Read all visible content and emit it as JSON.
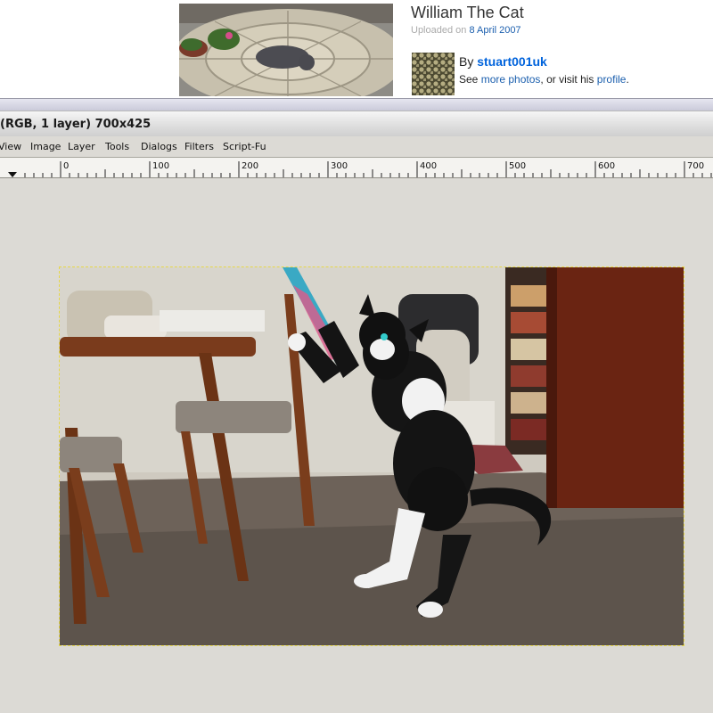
{
  "web_page": {
    "photo_title": "William The Cat",
    "uploaded_prefix": "Uploaded on",
    "uploaded_date": "8 April 2007",
    "by_prefix": "By",
    "owner": "stuart001uk",
    "see_prefix": "See",
    "more_photos": "more photos",
    "or_visit": ", or visit his",
    "profile": "profile",
    "period": "."
  },
  "gimp": {
    "window_title": "(RGB, 1 layer) 700x425",
    "menu": [
      "View",
      "Image",
      "Layer",
      "Tools",
      "Dialogs",
      "Filters",
      "Script-Fu"
    ],
    "ruler_labels": [
      "0",
      "100",
      "200",
      "300",
      "400",
      "500",
      "600",
      "700"
    ]
  },
  "icons": {
    "ruler_origin": "triangle-down-icon"
  },
  "colors": {
    "link": "#1b5fae",
    "owner_link": "#0063dc",
    "canvas_bg": "#dcdad5",
    "selection_marching_ants": "#e7d84a"
  }
}
